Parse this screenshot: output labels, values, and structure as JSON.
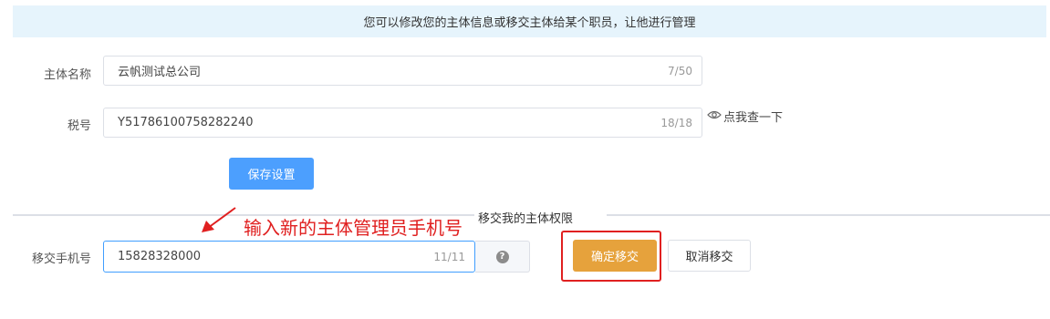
{
  "notice": "您可以修改您的主体信息或移交主体给某个职员，让他进行管理",
  "form": {
    "name_label": "主体名称",
    "name_value": "云帆测试总公司",
    "name_count": "7/50",
    "tax_label": "税号",
    "tax_value": "Y51786100758282240",
    "tax_count": "18/18",
    "tax_lookup": "点我查一下",
    "save_label": "保存设置"
  },
  "transfer": {
    "section_title": "移交我的主体权限",
    "annotation": "输入新的主体管理员手机号",
    "phone_label": "移交手机号",
    "phone_value": "15828328000",
    "phone_count": "11/11",
    "help_symbol": "?",
    "confirm_label": "确定移交",
    "cancel_label": "取消移交"
  },
  "colors": {
    "primary": "#4c9ffe",
    "warning": "#e6a23c",
    "highlight": "#e02020",
    "notice_bg": "#e6f4fc"
  },
  "icons": [
    "eye-icon",
    "help-icon",
    "arrow-icon"
  ]
}
